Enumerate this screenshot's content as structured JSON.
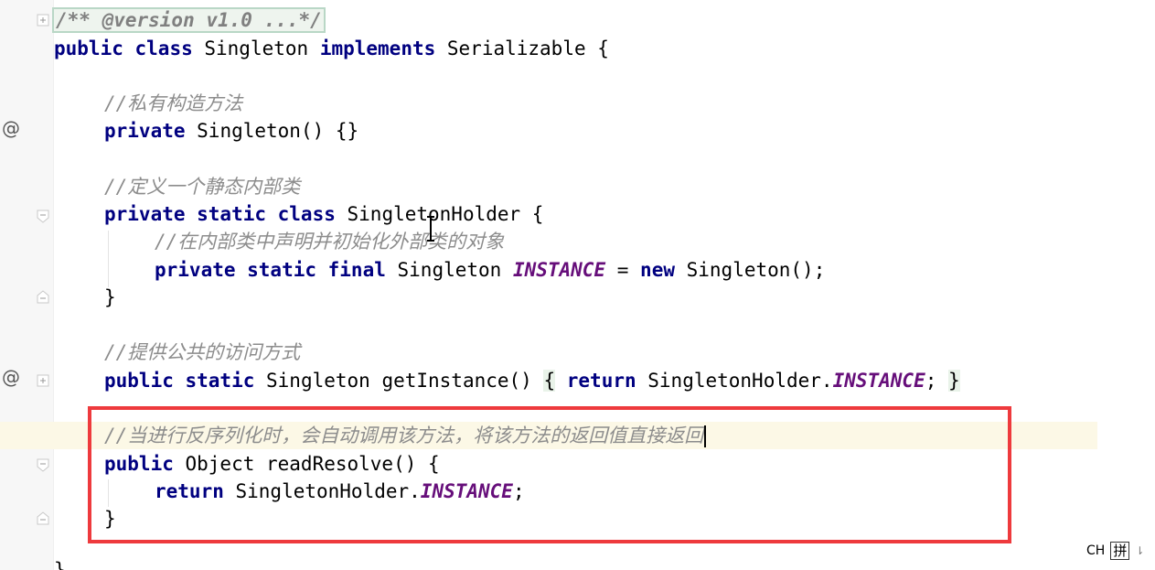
{
  "editor": {
    "lines": {
      "l1_doc": "/** @version v1.0 ...*/",
      "l2_public": "public",
      "l2_class": "class",
      "l2_name": " Singleton ",
      "l2_implements": "implements",
      "l2_rest": " Serializable {",
      "l4_comment": "//私有构造方法",
      "l5_private": "private",
      "l5_rest": " Singleton() {}",
      "l7_comment": "//定义一个静态内部类",
      "l8_kw": "private static class",
      "l8_rest": " SingletonHolder {",
      "l9_comment": "//在内部类中声明并初始化外部类的对象",
      "l10_kw": "private static final",
      "l10_type": " Singleton ",
      "l10_field": "INSTANCE",
      "l10_eq": " = ",
      "l10_new": "new",
      "l10_rest": " Singleton();",
      "l11_close": "}",
      "l13_comment": "//提供公共的访问方式",
      "l14_kw": "public static",
      "l14_sig": " Singleton getInstance() ",
      "l14_open": "{",
      "l14_sp": " ",
      "l14_return": "return",
      "l14_holder": " SingletonHolder.",
      "l14_field": "INSTANCE",
      "l14_semi": "; ",
      "l14_close": "}",
      "l16_comment": "//当进行反序列化时，会自动调用该方法，将该方法的返回值直接返回",
      "l17_public": "public",
      "l17_rest": " Object readResolve() {",
      "l18_return": "return",
      "l18_holder": " SingletonHolder.",
      "l18_field": "INSTANCE",
      "l18_semi": ";",
      "l19_close": "}",
      "l20_close": "}"
    },
    "gutter": {
      "override_marker": "@"
    }
  },
  "status": {
    "ime_lang": "CH",
    "ime_mode": "拼",
    "ime_arrow": "⇂"
  },
  "colors": {
    "keyword": "#000080",
    "comment": "#8c8c8c",
    "static_field": "#660e7a",
    "highlight_box": "#ee3a3d",
    "caret_line": "#fcf8e6"
  }
}
